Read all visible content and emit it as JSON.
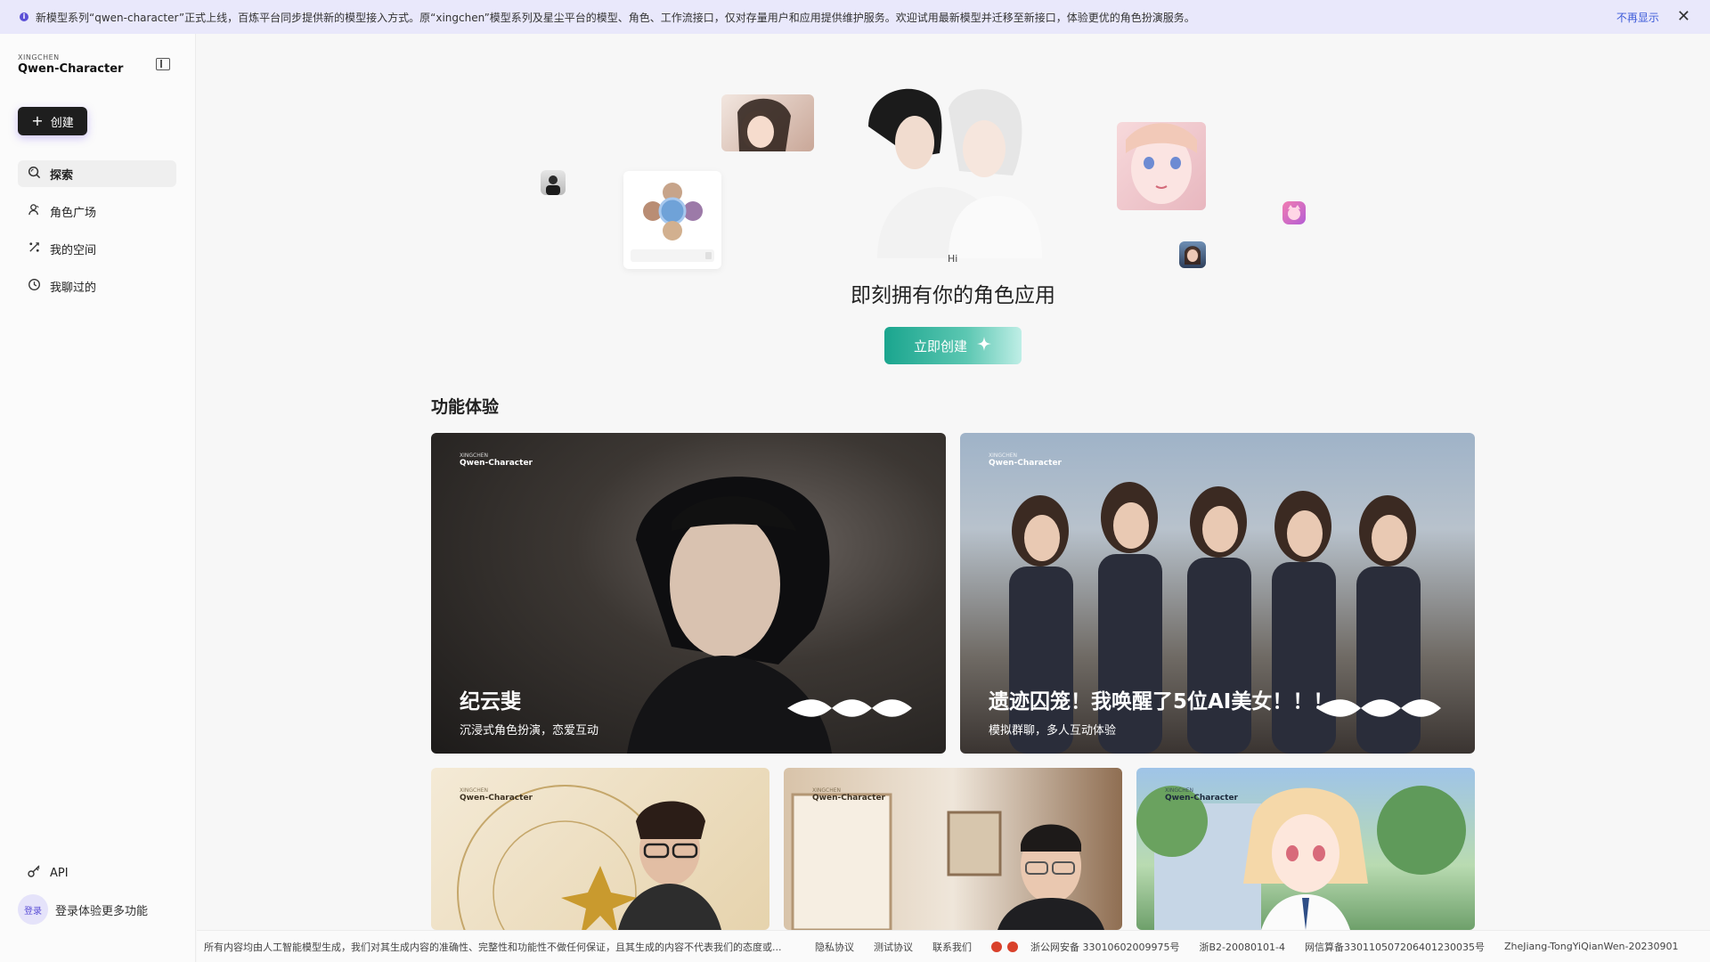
{
  "notice": {
    "message": "新模型系列“qwen-character”正式上线，百炼平台同步提供新的模型接入方式。原“xingchen”模型系列及星尘平台的模型、角色、工作流接口，仅对存量用户和应用提供维护服务。欢迎试用最新模型并迁移至新接口，体验更优的角色扮演服务。",
    "dismiss_label": "不再显示"
  },
  "sidebar": {
    "brand_sub": "XINGCHEN",
    "brand_name": "Qwen-Character",
    "create_label": "创建",
    "items": [
      {
        "label": "探索",
        "icon": "explore-icon"
      },
      {
        "label": "角色广场",
        "icon": "character-plaza-icon"
      },
      {
        "label": "我的空间",
        "icon": "my-space-icon"
      },
      {
        "label": "我聊过的",
        "icon": "history-icon"
      }
    ],
    "api_label": "API",
    "login_avatar": "登录",
    "login_text": "登录体验更多功能"
  },
  "hero": {
    "hi": "Hi",
    "title": "即刻拥有你的角色应用",
    "button_label": "立即创建"
  },
  "features": {
    "section_title": "功能体验",
    "brand_sub": "XINGCHEN",
    "brand_name": "Qwen-Character",
    "cards": [
      {
        "title": "纪云斐",
        "desc": "沉浸式角色扮演，恋爱互动"
      },
      {
        "title": "遗迹囚笼！我唤醒了5位AI美女！！！",
        "desc": "模拟群聊，多人互动体验"
      }
    ]
  },
  "footer": {
    "disclaimer": "所有内容均由人工智能模型生成，我们对其生成内容的准确性、完整性和功能性不做任何保证，且其生成的内容不代表我们的态度或...",
    "privacy": "隐私协议",
    "test": "测试协议",
    "contact": "联系我们",
    "police": "浙公网安备 33010602009975号",
    "icp": "浙B2-20080101-4",
    "netinfo": "网信算备330110507206401230035号",
    "model": "ZheJiang-TongYiQianWen-20230901"
  },
  "colors": {
    "accent": "#5b4fd6",
    "cta_start": "#1aa58e",
    "cta_end": "#bfeee6",
    "create_btn": "#1e1e1e"
  }
}
